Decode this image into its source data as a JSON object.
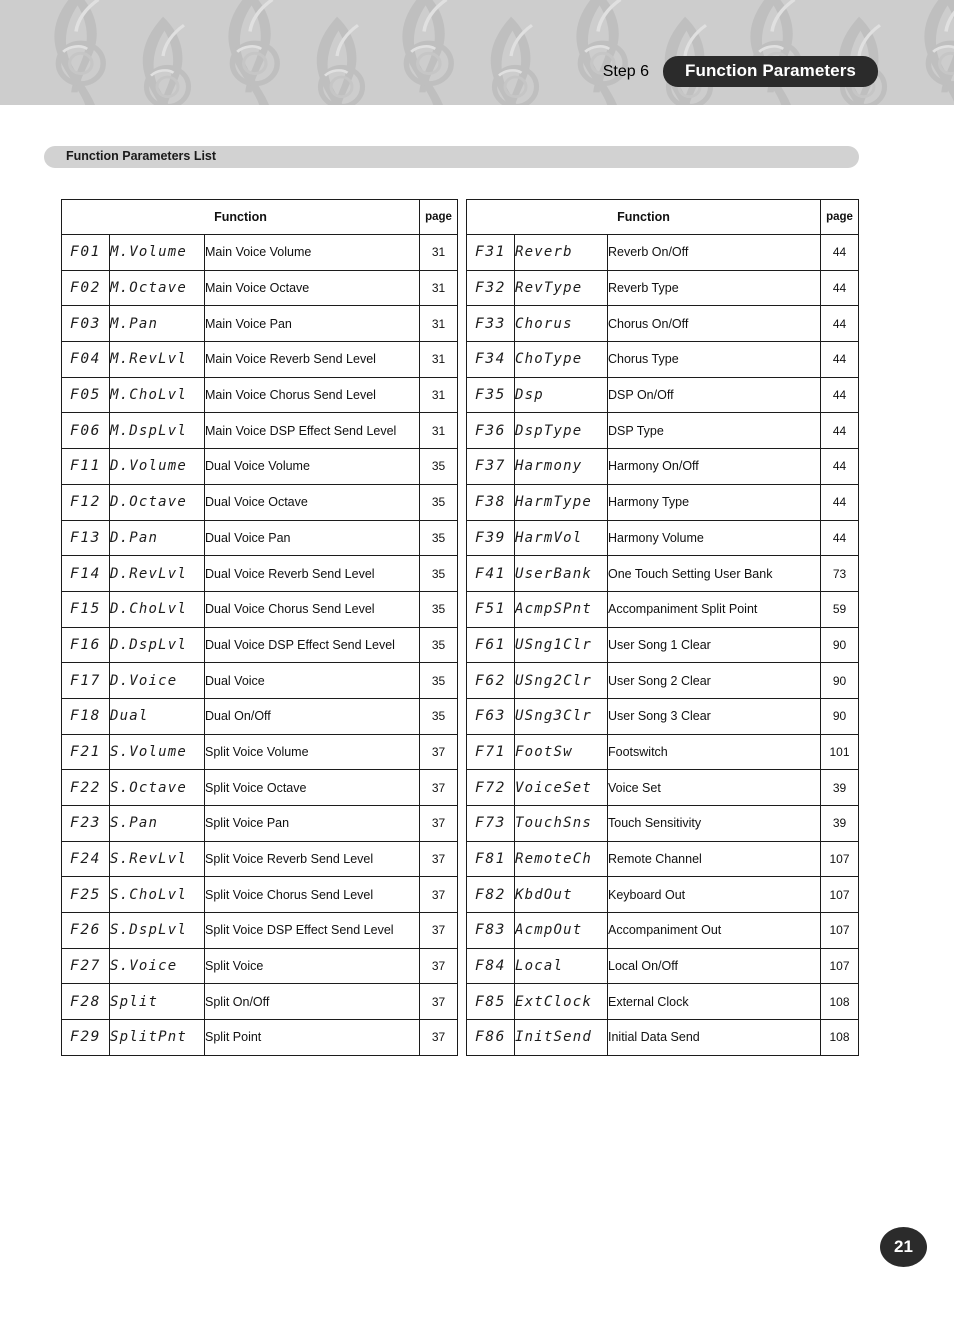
{
  "header": {
    "step_label": "Step 6",
    "title": "Function Parameters",
    "band_color": "#cdcdcd",
    "pill_color": "#2b2b2b",
    "watermark_icon": "treble-clef-icon"
  },
  "section": {
    "label": "Function Parameters List",
    "bar_color": "#d2d2d2"
  },
  "tables": {
    "columns": {
      "function": "Function",
      "page": "page"
    },
    "left_rows": [
      {
        "code": "F01",
        "lcd": "M.Volume",
        "desc": "Main Voice Volume",
        "page": "31"
      },
      {
        "code": "F02",
        "lcd": "M.Octave",
        "desc": "Main Voice Octave",
        "page": "31"
      },
      {
        "code": "F03",
        "lcd": "M.Pan",
        "desc": "Main Voice Pan",
        "page": "31"
      },
      {
        "code": "F04",
        "lcd": "M.RevLvl",
        "desc": "Main Voice Reverb Send Level",
        "page": "31"
      },
      {
        "code": "F05",
        "lcd": "M.ChoLvl",
        "desc": "Main Voice Chorus Send Level",
        "page": "31"
      },
      {
        "code": "F06",
        "lcd": "M.DspLvl",
        "desc": "Main Voice DSP Effect Send Level",
        "page": "31"
      },
      {
        "code": "F11",
        "lcd": "D.Volume",
        "desc": "Dual Voice Volume",
        "page": "35"
      },
      {
        "code": "F12",
        "lcd": "D.Octave",
        "desc": "Dual Voice Octave",
        "page": "35"
      },
      {
        "code": "F13",
        "lcd": "D.Pan",
        "desc": "Dual Voice Pan",
        "page": "35"
      },
      {
        "code": "F14",
        "lcd": "D.RevLvl",
        "desc": "Dual Voice Reverb Send Level",
        "page": "35"
      },
      {
        "code": "F15",
        "lcd": "D.ChoLvl",
        "desc": "Dual Voice Chorus Send Level",
        "page": "35"
      },
      {
        "code": "F16",
        "lcd": "D.DspLvl",
        "desc": "Dual Voice DSP Effect Send Level",
        "page": "35"
      },
      {
        "code": "F17",
        "lcd": "D.Voice",
        "desc": "Dual Voice",
        "page": "35"
      },
      {
        "code": "F18",
        "lcd": "Dual",
        "desc": "Dual On/Off",
        "page": "35"
      },
      {
        "code": "F21",
        "lcd": "S.Volume",
        "desc": "Split Voice Volume",
        "page": "37"
      },
      {
        "code": "F22",
        "lcd": "S.Octave",
        "desc": "Split Voice Octave",
        "page": "37"
      },
      {
        "code": "F23",
        "lcd": "S.Pan",
        "desc": "Split Voice Pan",
        "page": "37"
      },
      {
        "code": "F24",
        "lcd": "S.RevLvl",
        "desc": "Split Voice Reverb Send Level",
        "page": "37"
      },
      {
        "code": "F25",
        "lcd": "S.ChoLvl",
        "desc": "Split Voice Chorus Send Level",
        "page": "37"
      },
      {
        "code": "F26",
        "lcd": "S.DspLvl",
        "desc": "Split Voice DSP Effect Send Level",
        "page": "37"
      },
      {
        "code": "F27",
        "lcd": "S.Voice",
        "desc": "Split Voice",
        "page": "37"
      },
      {
        "code": "F28",
        "lcd": "Split",
        "desc": "Split On/Off",
        "page": "37"
      },
      {
        "code": "F29",
        "lcd": "SplitPnt",
        "desc": "Split Point",
        "page": "37"
      }
    ],
    "right_rows": [
      {
        "code": "F31",
        "lcd": "Reverb",
        "desc": "Reverb On/Off",
        "page": "44"
      },
      {
        "code": "F32",
        "lcd": "RevType",
        "desc": "Reverb Type",
        "page": "44"
      },
      {
        "code": "F33",
        "lcd": "Chorus",
        "desc": "Chorus On/Off",
        "page": "44"
      },
      {
        "code": "F34",
        "lcd": "ChoType",
        "desc": "Chorus Type",
        "page": "44"
      },
      {
        "code": "F35",
        "lcd": "Dsp",
        "desc": "DSP On/Off",
        "page": "44"
      },
      {
        "code": "F36",
        "lcd": "DspType",
        "desc": "DSP Type",
        "page": "44"
      },
      {
        "code": "F37",
        "lcd": "Harmony",
        "desc": "Harmony On/Off",
        "page": "44"
      },
      {
        "code": "F38",
        "lcd": "HarmType",
        "desc": "Harmony Type",
        "page": "44"
      },
      {
        "code": "F39",
        "lcd": "HarmVol",
        "desc": "Harmony Volume",
        "page": "44"
      },
      {
        "code": "F41",
        "lcd": "UserBank",
        "desc": "One Touch Setting User Bank",
        "page": "73"
      },
      {
        "code": "F51",
        "lcd": "AcmpSPnt",
        "desc": "Accompaniment Split Point",
        "page": "59"
      },
      {
        "code": "F61",
        "lcd": "USng1Clr",
        "desc": "User Song 1 Clear",
        "page": "90"
      },
      {
        "code": "F62",
        "lcd": "USng2Clr",
        "desc": "User Song 2 Clear",
        "page": "90"
      },
      {
        "code": "F63",
        "lcd": "USng3Clr",
        "desc": "User Song 3 Clear",
        "page": "90"
      },
      {
        "code": "F71",
        "lcd": "FootSw",
        "desc": "Footswitch",
        "page": "101"
      },
      {
        "code": "F72",
        "lcd": "VoiceSet",
        "desc": "Voice Set",
        "page": "39"
      },
      {
        "code": "F73",
        "lcd": "TouchSns",
        "desc": "Touch Sensitivity",
        "page": "39"
      },
      {
        "code": "F81",
        "lcd": "RemoteCh",
        "desc": "Remote Channel",
        "page": "107"
      },
      {
        "code": "F82",
        "lcd": "KbdOut",
        "desc": "Keyboard Out",
        "page": "107"
      },
      {
        "code": "F83",
        "lcd": "AcmpOut",
        "desc": "Accompaniment Out",
        "page": "107"
      },
      {
        "code": "F84",
        "lcd": "Local",
        "desc": "Local On/Off",
        "page": "107"
      },
      {
        "code": "F85",
        "lcd": "ExtClock",
        "desc": "External Clock",
        "page": "108"
      },
      {
        "code": "F86",
        "lcd": "InitSend",
        "desc": "Initial Data Send",
        "page": "108"
      }
    ]
  },
  "footer": {
    "page_number": "21",
    "badge_color": "#2b2b2b"
  }
}
